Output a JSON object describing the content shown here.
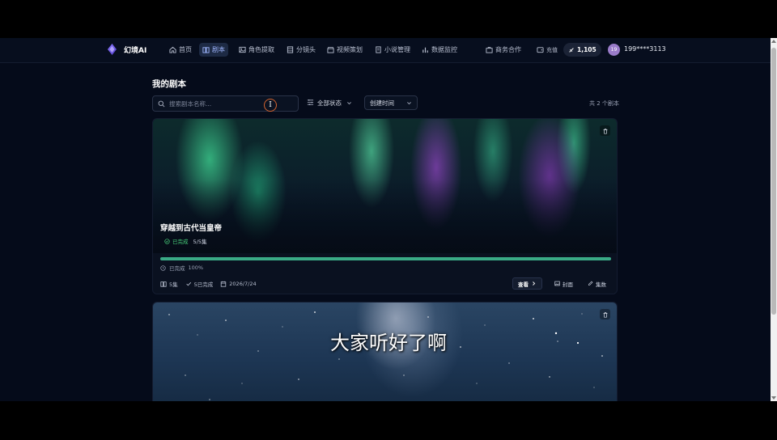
{
  "brand": {
    "name": "幻境AI"
  },
  "nav": {
    "items": [
      {
        "label": "首页",
        "icon": "home-icon",
        "active": false
      },
      {
        "label": "剧本",
        "icon": "book-icon",
        "active": true
      },
      {
        "label": "角色提取",
        "icon": "image-icon",
        "active": false
      },
      {
        "label": "分镜头",
        "icon": "film-icon",
        "active": false
      },
      {
        "label": "视频策划",
        "icon": "clapper-icon",
        "active": false
      },
      {
        "label": "小说管理",
        "icon": "document-icon",
        "active": false
      },
      {
        "label": "数据监控",
        "icon": "bar-chart-icon",
        "active": false
      }
    ],
    "business_label": "商务合作",
    "recharge_label": "充值",
    "credits": "1,105",
    "avatar_text": "19",
    "username": "199****3113"
  },
  "page": {
    "title": "我的剧本",
    "search_placeholder": "搜索剧本名称...",
    "status_filter": "全部状态",
    "sort_filter": "创建时间",
    "count_text": "共 2 个剧本"
  },
  "scripts": [
    {
      "title": "穿越到古代当皇帝",
      "status": "已完成",
      "episodes_progress": "5/5集",
      "progress_label": "已完成",
      "progress_value": "100%",
      "progress_fraction": 1.0,
      "episodes": "5集",
      "completed": "5已完成",
      "date": "2026/7/24",
      "view_label": "查看",
      "cover_label": "封面",
      "episodes_label": "集数"
    },
    {
      "title": ""
    }
  ],
  "video_subtitle": "大家听好了啊",
  "colors": {
    "background": "#050b1a",
    "accent": "#9fb6ff",
    "progress": "#3aaa86",
    "success": "#48d07a",
    "cursor_ring": "#d4642e"
  }
}
